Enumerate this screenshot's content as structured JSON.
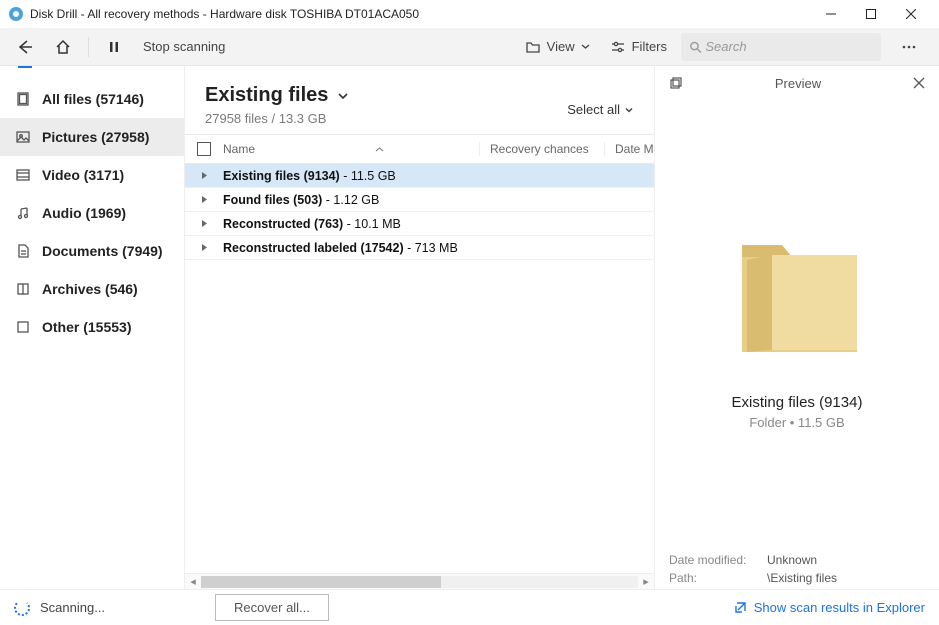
{
  "window": {
    "title": "Disk Drill - All recovery methods - Hardware disk TOSHIBA DT01ACA050"
  },
  "toolbar": {
    "stop_label": "Stop scanning",
    "view_label": "View",
    "filters_label": "Filters",
    "search_placeholder": "Search"
  },
  "sidebar": {
    "items": [
      {
        "icon": "files",
        "label": "All files (57146)"
      },
      {
        "icon": "pictures",
        "label": "Pictures (27958)"
      },
      {
        "icon": "video",
        "label": "Video (3171)"
      },
      {
        "icon": "audio",
        "label": "Audio (1969)"
      },
      {
        "icon": "docs",
        "label": "Documents (7949)"
      },
      {
        "icon": "archives",
        "label": "Archives (546)"
      },
      {
        "icon": "other",
        "label": "Other (15553)"
      }
    ],
    "selected_index": 1
  },
  "crumb": {
    "title": "Existing files",
    "subtitle": "27958 files / 13.3 GB",
    "select_all": "Select all"
  },
  "columns": {
    "name": "Name",
    "recovery": "Recovery chances",
    "date": "Date M"
  },
  "rows": [
    {
      "name": "Existing files (9134)",
      "size": "11.5 GB",
      "selected": true
    },
    {
      "name": "Found files (503)",
      "size": "1.12 GB",
      "selected": false
    },
    {
      "name": "Reconstructed (763)",
      "size": "10.1 MB",
      "selected": false
    },
    {
      "name": "Reconstructed labeled (17542)",
      "size": "713 MB",
      "selected": false
    }
  ],
  "preview": {
    "panel_title": "Preview",
    "name": "Existing files (9134)",
    "meta": "Folder • 11.5 GB",
    "date_modified_label": "Date modified:",
    "date_modified_value": "Unknown",
    "path_label": "Path:",
    "path_value": "\\Existing files"
  },
  "footer": {
    "status": "Scanning...",
    "recover": "Recover all...",
    "explorer": "Show scan results in Explorer"
  }
}
